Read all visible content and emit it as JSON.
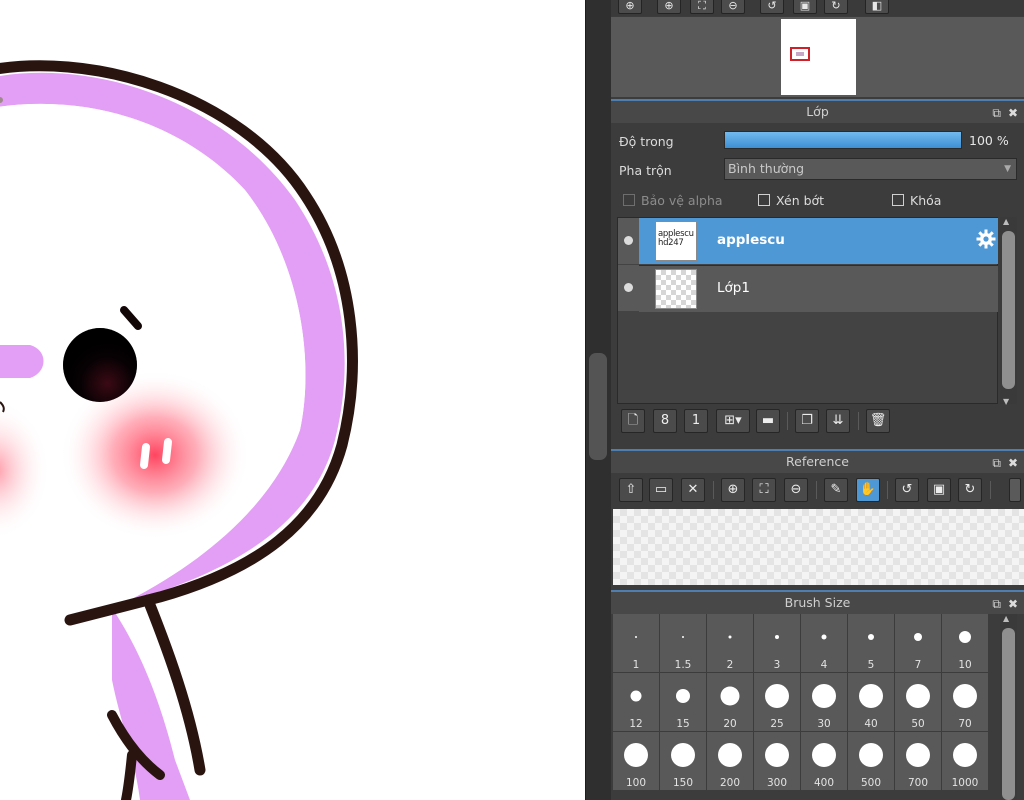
{
  "canvas": {
    "artwork": "pink-blob-character"
  },
  "navigator": {
    "tools": [
      "zoom-in-icon",
      "zoom-in-alt-icon",
      "fit-icon",
      "zoom-out-icon",
      "rotate-left-icon",
      "fit-window-icon",
      "rotate-right-icon",
      "flip-icon"
    ]
  },
  "layer_panel": {
    "title": "Lớp",
    "opacity_label": "Độ trong",
    "opacity_value": "100 %",
    "opacity_fraction": 1.0,
    "blend_label": "Pha trộn",
    "blend_value": "Bình thường",
    "protect_alpha_label": "Bảo vệ alpha",
    "clipping_label": "Xén bớt",
    "lock_label": "Khóa",
    "layers": [
      {
        "name": "applescu",
        "thumb_text": "applescu hd247",
        "selected": true
      },
      {
        "name": "Lớp1",
        "thumb_text": "",
        "selected": false
      }
    ],
    "toolbar": [
      "new-layer-icon",
      "new-halftone-layer-icon",
      "new-image-layer-icon",
      "add-layer-menu-icon",
      "folder-icon",
      "duplicate-layer-icon",
      "merge-down-icon",
      "delete-layer-icon"
    ]
  },
  "reference_panel": {
    "title": "Reference",
    "toolbar": [
      "upload-icon",
      "open-folder-icon",
      "close-icon",
      "zoom-in-icon",
      "fit-icon",
      "zoom-out-icon",
      "eyedropper-icon",
      "hand-icon",
      "rotate-left-icon",
      "fit-window-icon",
      "rotate-right-icon"
    ],
    "active_tool": "hand-icon"
  },
  "brush_size_panel": {
    "title": "Brush Size",
    "sizes": [
      "1",
      "1.5",
      "2",
      "3",
      "4",
      "5",
      "7",
      "10",
      "12",
      "15",
      "20",
      "25",
      "30",
      "40",
      "50",
      "70",
      "100",
      "150",
      "200",
      "300",
      "400",
      "500",
      "700",
      "1000"
    ]
  },
  "colors": {
    "accent": "#4f98d6",
    "panel_bg": "#3c3c3c",
    "title_border": "#4f7fb0",
    "character_pink": "#e39ff5",
    "blush": "#ff5a6e",
    "outline": "#2a1410"
  }
}
